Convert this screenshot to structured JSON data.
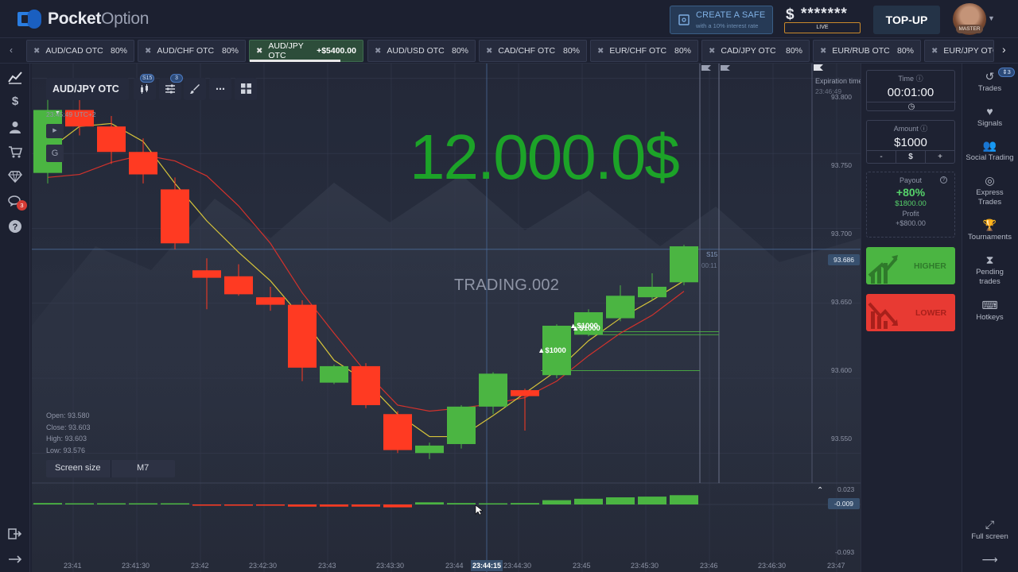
{
  "header": {
    "logo_bold": "Pocket",
    "logo_light": "Option",
    "create_safe_title": "CREATE A SAFE",
    "create_safe_sub": "with a 10% interest rate",
    "balance_currency": "$",
    "balance_masked": "*******",
    "account_type": "LIVE",
    "topup_label": "TOP-UP",
    "avatar_badge": "MASTER"
  },
  "assets": [
    {
      "name": "AUD/CAD OTC",
      "payout": "80%"
    },
    {
      "name": "AUD/CHF OTC",
      "payout": "80%"
    },
    {
      "name": "AUD/JPY OTC",
      "payout": "+$5400.00",
      "active": true
    },
    {
      "name": "AUD/USD OTC",
      "payout": "80%"
    },
    {
      "name": "CAD/CHF OTC",
      "payout": "80%"
    },
    {
      "name": "EUR/CHF OTC",
      "payout": "80%"
    },
    {
      "name": "CAD/JPY OTC",
      "payout": "80%"
    },
    {
      "name": "EUR/RUB OTC",
      "payout": "80%"
    },
    {
      "name": "EUR/JPY OTC",
      "payout": ""
    }
  ],
  "toolbar": {
    "asset": "AUD/JPY OTC",
    "timeframe_badge": "S15",
    "indicators_badge": "3",
    "server_time": "23:45:49 UTC+2"
  },
  "overlay": {
    "big_amount": "12.000.0$",
    "watermark": "TRADING.002"
  },
  "ohlc": {
    "open": "Open: 93.580",
    "close": "Close: 93.603",
    "high": "High: 93.603",
    "low": "Low: 93.576"
  },
  "screen_size": {
    "label": "Screen size",
    "value": "M7"
  },
  "price_axis": [
    "93.800",
    "93.750",
    "93.700",
    "93.650",
    "93.600",
    "93.550"
  ],
  "current_price": "93.686",
  "indicator_axis": {
    "top": "0.023",
    "current": "-0.009",
    "bottom": "-0.093"
  },
  "time_axis": [
    "23:41",
    "23:41:30",
    "23:42",
    "23:42:30",
    "23:43",
    "23:43:30",
    "23:44",
    "23:44:30",
    "23:45",
    "23:45:30",
    "23:46",
    "23:46:30",
    "23:47"
  ],
  "time_current": "23:44:15",
  "expiration": {
    "label": "Expiration time",
    "time": "23:46:49"
  },
  "countdown": {
    "period": "S15",
    "time": "00:11"
  },
  "trade_labels": [
    "$1000",
    "$1000",
    "$1000"
  ],
  "trade_panel": {
    "time_title": "Time",
    "time_value": "00:01:00",
    "amount_title": "Amount",
    "amount_value": "$1000",
    "amount_minus": "-",
    "amount_currency": "$",
    "amount_plus": "+",
    "payout_title": "Payout",
    "payout_pct": "+80%",
    "payout_amount": "$1800.00",
    "profit_label": "Profit",
    "profit_value": "+$800.00",
    "higher_label": "HIGHER",
    "lower_label": "LOWER"
  },
  "right_nav": [
    {
      "label": "Trades",
      "icon": "history-icon"
    },
    {
      "label": "Signals",
      "icon": "heartbeat-icon"
    },
    {
      "label": "Social Trading",
      "icon": "users-icon"
    },
    {
      "label": "Express Trades",
      "icon": "target-icon"
    },
    {
      "label": "Tournaments",
      "icon": "trophy-icon"
    },
    {
      "label": "Pending trades",
      "icon": "hourglass-icon"
    },
    {
      "label": "Hotkeys",
      "icon": "keyboard-icon"
    }
  ],
  "trades_badge": "3",
  "fullscreen_label": "Full screen",
  "chat_badge": "3",
  "colors": {
    "bull": "#4bb542",
    "bear": "#ff3a22",
    "accent": "#1ca328",
    "background": "#1e2232"
  },
  "chart_data": {
    "type": "candlestick",
    "x": [
      "23:41",
      "23:41:15",
      "23:41:30",
      "23:41:45",
      "23:42",
      "23:42:15",
      "23:42:30",
      "23:42:45",
      "23:43",
      "23:43:15",
      "23:43:30",
      "23:43:45",
      "23:44",
      "23:44:15",
      "23:44:30",
      "23:44:45",
      "23:45",
      "23:45:15",
      "23:45:30",
      "23:45:45",
      "23:46"
    ],
    "candles": [
      {
        "o": 93.737,
        "c": 93.779,
        "h": 93.79,
        "l": 93.73
      },
      {
        "o": 93.779,
        "c": 93.768,
        "h": 93.792,
        "l": 93.762
      },
      {
        "o": 93.768,
        "c": 93.751,
        "h": 93.775,
        "l": 93.743
      },
      {
        "o": 93.751,
        "c": 93.736,
        "h": 93.76,
        "l": 93.73
      },
      {
        "o": 93.726,
        "c": 93.69,
        "h": 93.734,
        "l": 93.686
      },
      {
        "o": 93.672,
        "c": 93.667,
        "h": 93.68,
        "l": 93.646
      },
      {
        "o": 93.668,
        "c": 93.656,
        "h": 93.676,
        "l": 93.655
      },
      {
        "o": 93.654,
        "c": 93.649,
        "h": 93.661,
        "l": 93.645
      },
      {
        "o": 93.649,
        "c": 93.607,
        "h": 93.652,
        "l": 93.598
      },
      {
        "o": 93.597,
        "c": 93.608,
        "h": 93.609,
        "l": 93.596
      },
      {
        "o": 93.608,
        "c": 93.582,
        "h": 93.61,
        "l": 93.58
      },
      {
        "o": 93.576,
        "c": 93.552,
        "h": 93.578,
        "l": 93.55
      },
      {
        "o": 93.55,
        "c": 93.555,
        "h": 93.557,
        "l": 93.546
      },
      {
        "o": 93.556,
        "c": 93.581,
        "h": 93.582,
        "l": 93.553
      },
      {
        "o": 93.581,
        "c": 93.603,
        "h": 93.604,
        "l": 93.576
      },
      {
        "o": 93.592,
        "c": 93.588,
        "h": 93.593,
        "l": 93.565
      },
      {
        "o": 93.602,
        "c": 93.635,
        "h": 93.636,
        "l": 93.6
      },
      {
        "o": 93.629,
        "c": 93.644,
        "h": 93.646,
        "l": 93.628
      },
      {
        "o": 93.64,
        "c": 93.655,
        "h": 93.662,
        "l": 93.638
      },
      {
        "o": 93.654,
        "c": 93.661,
        "h": 93.67,
        "l": 93.652
      },
      {
        "o": 93.664,
        "c": 93.688,
        "h": 93.689,
        "l": 93.662
      }
    ],
    "ma_fast": [
      93.752,
      93.768,
      93.77,
      93.758,
      93.73,
      93.705,
      93.684,
      93.665,
      93.64,
      93.612,
      93.598,
      93.576,
      93.561,
      93.561,
      93.575,
      93.59,
      93.605,
      93.625,
      93.64,
      93.652,
      93.665
    ],
    "ma_slow": [
      93.734,
      93.736,
      93.744,
      93.749,
      93.745,
      93.735,
      93.715,
      93.69,
      93.657,
      93.63,
      93.604,
      93.582,
      93.578,
      93.58,
      93.583,
      93.587,
      93.598,
      93.615,
      93.63,
      93.642,
      93.658
    ],
    "oscillator": [
      0.002,
      0.001,
      0.001,
      0.001,
      0.0,
      -0.001,
      -0.001,
      -0.001,
      -0.003,
      -0.003,
      -0.003,
      -0.004,
      0.003,
      0.002,
      0.0,
      0.002,
      0.006,
      0.008,
      0.01,
      0.011,
      0.013
    ],
    "ylim": [
      93.53,
      93.81
    ],
    "osc_ylim": [
      -0.093,
      0.023
    ],
    "current_price": 93.686
  }
}
